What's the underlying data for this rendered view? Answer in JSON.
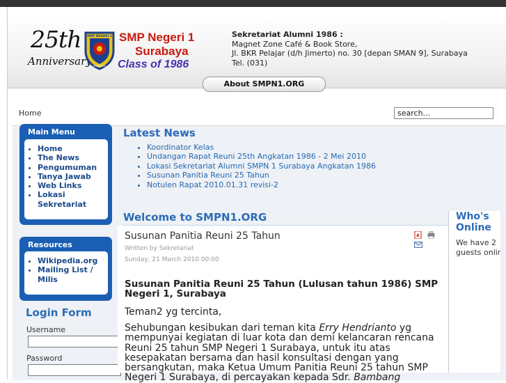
{
  "header": {
    "logo_25th": "25th",
    "logo_anniversary": "Anniversary",
    "logo_school_line1": "SMP Negeri 1",
    "logo_school_line2": "Surabaya",
    "logo_class": "Class of 1986",
    "emblem_text_top": "SMP NEGERI 1",
    "emblem_text_bottom": "SURABAYA",
    "contact": {
      "title": "Sekretariat Alumni 1986 :",
      "line1": "Magnet Zone Café & Book Store,",
      "line2": "Jl. BKR Pelajar (d/h Jimerto) no. 30 [depan SMAN 9], Surabaya",
      "line3": "Tel. (031)"
    },
    "about_tab": "About SMPN1.ORG"
  },
  "breadcrumb": "Home",
  "search": {
    "value": "search..."
  },
  "main_menu": {
    "title": "Main Menu",
    "items": [
      "Home",
      "The News",
      "Pengumuman",
      "Tanya Jawab",
      "Web Links",
      "Lokasi Sekretariat"
    ]
  },
  "resources": {
    "title": "Resources",
    "items": [
      "Wikipedia.org",
      "Mailing List / Milis"
    ]
  },
  "login": {
    "title": "Login Form",
    "username_label": "Username",
    "password_label": "Password"
  },
  "latest_news": {
    "title": "Latest News",
    "items": [
      "Koordinator Kelas",
      "Undangan Rapat Reuni 25th Angkatan 1986 - 2 Mei 2010",
      "Lokasi Sekretariat Alumni SMPN 1 Surabaya Angkatan 1986",
      "Susunan Panitia Reuni 25 Tahun",
      "Notulen Rapat 2010.01.31 revisi-2"
    ]
  },
  "welcome_title": "Welcome to SMPN1.ORG",
  "article": {
    "title": "Susunan Panitia Reuni 25 Tahun",
    "author": "Written by Sekretariat",
    "date": "Sunday, 21 March 2010 00:00",
    "heading": "Susunan Panitia Reuni 25 Tahun (Lulusan tahun 1986) SMP Negeri 1, Surabaya",
    "greeting": "Teman2 yg tercinta,",
    "body_pre": "Sehubungan kesibukan dari teman kita ",
    "body_name1": "Erry Hendrianto",
    "body_mid": " yg mempunyai kegiatan di luar kota dan demi kelancaran rencana Reuni 25 tahun SMP Negeri 1 Surabaya, untuk itu atas kesepakatan bersama dan hasil konsultasi dengan yang bersangkutan, maka Ketua Umum  Panitia Reuni 25 tahun SMP Negeri 1 Surabaya, di percayakan kepada Sdr. ",
    "body_name2": "Bambang"
  },
  "whos_online": {
    "title": "Who's Online",
    "text_line1": "We have 2",
    "text_line2": "guests online"
  },
  "colors": {
    "accent": "#2c6cb8",
    "module_blue": "#1a5fb4",
    "logo_red": "#c81a10",
    "logo_purple": "#4830b0"
  }
}
